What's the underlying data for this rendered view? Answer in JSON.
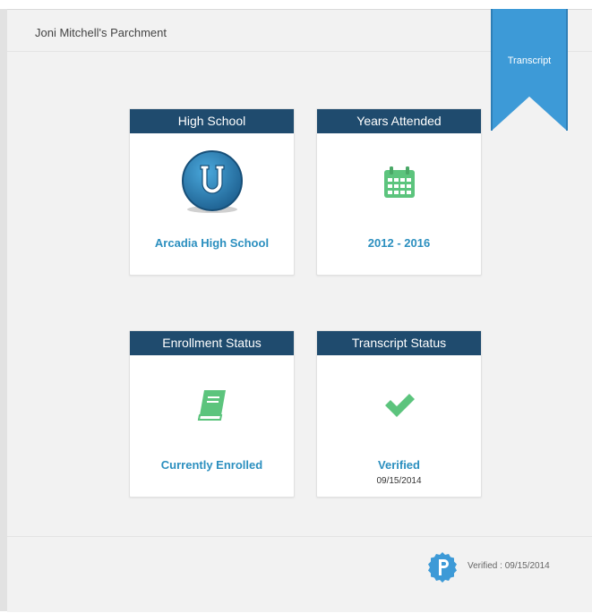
{
  "header": {
    "title": "Joni Mitchell's Parchment"
  },
  "ribbon": {
    "label": "Transcript"
  },
  "cards": {
    "high_school": {
      "heading": "High School",
      "value": "Arcadia High School",
      "icon": "school-logo-u"
    },
    "years": {
      "heading": "Years Attended",
      "value": "2012 - 2016",
      "icon": "calendar-icon"
    },
    "enrollment": {
      "heading": "Enrollment Status",
      "value": "Currently Enrolled",
      "icon": "book-icon"
    },
    "transcript": {
      "heading": "Transcript Status",
      "value": "Verified",
      "date": "09/15/2014",
      "icon": "checkmark-icon"
    }
  },
  "footer": {
    "badge_icon": "parchment-p-logo",
    "verified_text": "Verified : 09/15/2014"
  },
  "colors": {
    "card_header": "#1f4b6e",
    "value_text": "#2b8fbf",
    "ribbon": "#3d9ad7",
    "icon_green": "#5cc47d"
  }
}
